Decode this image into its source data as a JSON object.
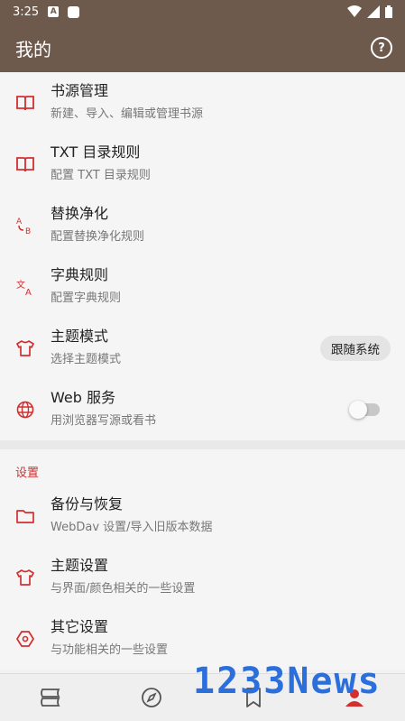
{
  "status_bar": {
    "time": "3:25",
    "notif_letter": "A"
  },
  "app_bar": {
    "title": "我的",
    "help_icon": "help-circle-icon"
  },
  "main_items": [
    {
      "title": "书源管理",
      "subtitle": "新建、导入、编辑或管理书源",
      "icon": "book-open-icon"
    },
    {
      "title": "TXT 目录规则",
      "subtitle": "配置 TXT 目录规则",
      "icon": "book-open-icon"
    },
    {
      "title": "替换净化",
      "subtitle": "配置替换净化规则",
      "icon": "replace-icon"
    },
    {
      "title": "字典规则",
      "subtitle": "配置字典规则",
      "icon": "translate-icon"
    },
    {
      "title": "主题模式",
      "subtitle": "选择主题模式",
      "value": "跟随系统",
      "icon": "shirt-icon"
    },
    {
      "title": "Web 服务",
      "subtitle": "用浏览器写源或看书",
      "icon": "globe-icon",
      "toggle": false
    }
  ],
  "settings_section": {
    "header": "设置",
    "items": [
      {
        "title": "备份与恢复",
        "subtitle": "WebDav 设置/导入旧版本数据",
        "icon": "folder-icon"
      },
      {
        "title": "主题设置",
        "subtitle": "与界面/颜色相关的一些设置",
        "icon": "shirt-icon"
      },
      {
        "title": "其它设置",
        "subtitle": "与功能相关的一些设置",
        "icon": "hexagon-icon"
      }
    ]
  },
  "bottom_nav": [
    "bookshelf-icon",
    "compass-icon",
    "bookmark-icon",
    "person-icon"
  ],
  "watermark": "1233News",
  "colors": {
    "primary": "#6d5a4d",
    "accent": "#d32f2f"
  }
}
